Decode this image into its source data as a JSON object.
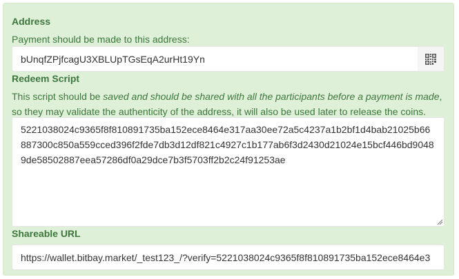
{
  "address": {
    "label": "Address",
    "help": "Payment should be made to this address:",
    "value": "bUnqfZPjfcagU3XBLUpTGsEqA2urHt19Yn",
    "qr_icon": "qr-code-icon"
  },
  "redeem_script": {
    "label": "Redeem Script",
    "help_prefix": "This script should be ",
    "help_emphasis": "saved and should be shared with all the participants before a payment is made",
    "help_suffix": ",",
    "help_line2": "so they may validate the authenticity of the address, it will also be used later to release the coins.",
    "value": "5221038024c9365f8f810891735ba152ece8464e317aa30ee72a5c4237a1b2bf1d4bab21025b66887300c850a559cced396f2fde7db3d12df821c4927c1b177ab6f3d2430d21024e15bcf446bd90489de58502887eea57286df0a29dce7b3f5703ff2b2c24f91253ae"
  },
  "shareable_url": {
    "label": "Shareable URL",
    "value": "https://wallet.bitbay.market/_test123_/?verify=5221038024c9365f8f810891735ba152ece8464e3"
  },
  "colors": {
    "panel_bg": "#dff0d8",
    "label_text": "#3c763d"
  }
}
